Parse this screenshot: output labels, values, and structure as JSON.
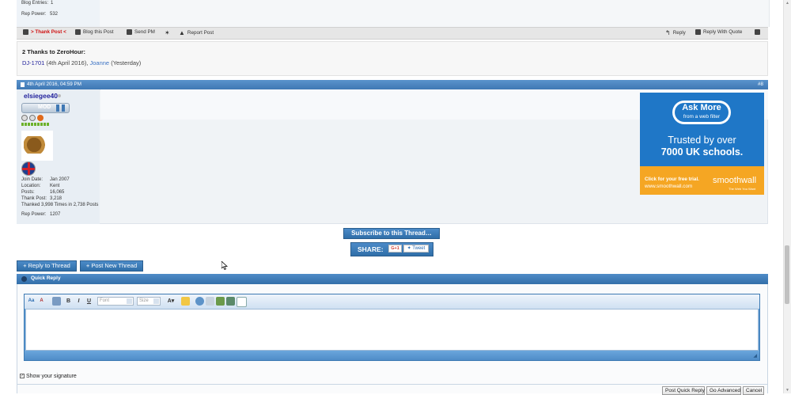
{
  "prev_post": {
    "blog_entries_label": "Blog Entries:",
    "blog_entries_value": "1",
    "rep_power_label": "Rep Power:",
    "rep_power_value": "532"
  },
  "postbar": {
    "thank_post": "> Thank Post <",
    "blog_post": "Blog this Post",
    "send_pm": "Send PM",
    "report_post": "Report Post",
    "reply": "Reply",
    "reply_with_quote": "Reply With Quote"
  },
  "thanks": {
    "title": "2 Thanks to ZeroHour:",
    "user1": "DJ-1701",
    "user1_date": "(4th April 2016),",
    "user2": "Joanne",
    "user2_date": "(Yesterday)"
  },
  "post": {
    "date": "4th April 2016, 04:59 PM",
    "number": "#8",
    "username": "elsiegee40",
    "rank_label": "MOD",
    "details": [
      {
        "label": "Join Date:",
        "value": "Jan 2007"
      },
      {
        "label": "Location:",
        "value": "Kent"
      },
      {
        "label": "Posts:",
        "value": "16,065"
      },
      {
        "label": "Thank Post:",
        "value": "3,218"
      }
    ],
    "thanked_line": "Thanked 3,998 Times in 2,738 Posts",
    "rep_power_label": "Rep Power:",
    "rep_power_value": "1207"
  },
  "ad": {
    "ask_more": "Ask More",
    "from_filter": "from a web filter",
    "trusted1": "Trusted by over",
    "trusted2": "7000 UK schools.",
    "click": "Click for your free trial.",
    "url": "www.smoothwall.com",
    "brand": "smoothwall",
    "tagline": "The Web You Want"
  },
  "subscribe_label": "Subscribe to this Thread…",
  "share": {
    "label": "SHARE:",
    "gplus": "G+1",
    "tweet": "Tweet"
  },
  "buttons": {
    "reply_thread": "+ Reply to Thread",
    "new_thread": "+ Post New Thread"
  },
  "quick_reply": {
    "title": "Quick Reply",
    "font_placeholder": "Font",
    "size_placeholder": "Size",
    "show_signature": "Show your signature",
    "post_button": "Post Quick Reply",
    "advanced_button": "Go Advanced",
    "cancel_button": "Cancel"
  },
  "colors": {
    "header_blue": "#3f78b4",
    "thank_red": "#d01010",
    "link_blue": "#22229c",
    "ad_orange": "#f5a623"
  }
}
